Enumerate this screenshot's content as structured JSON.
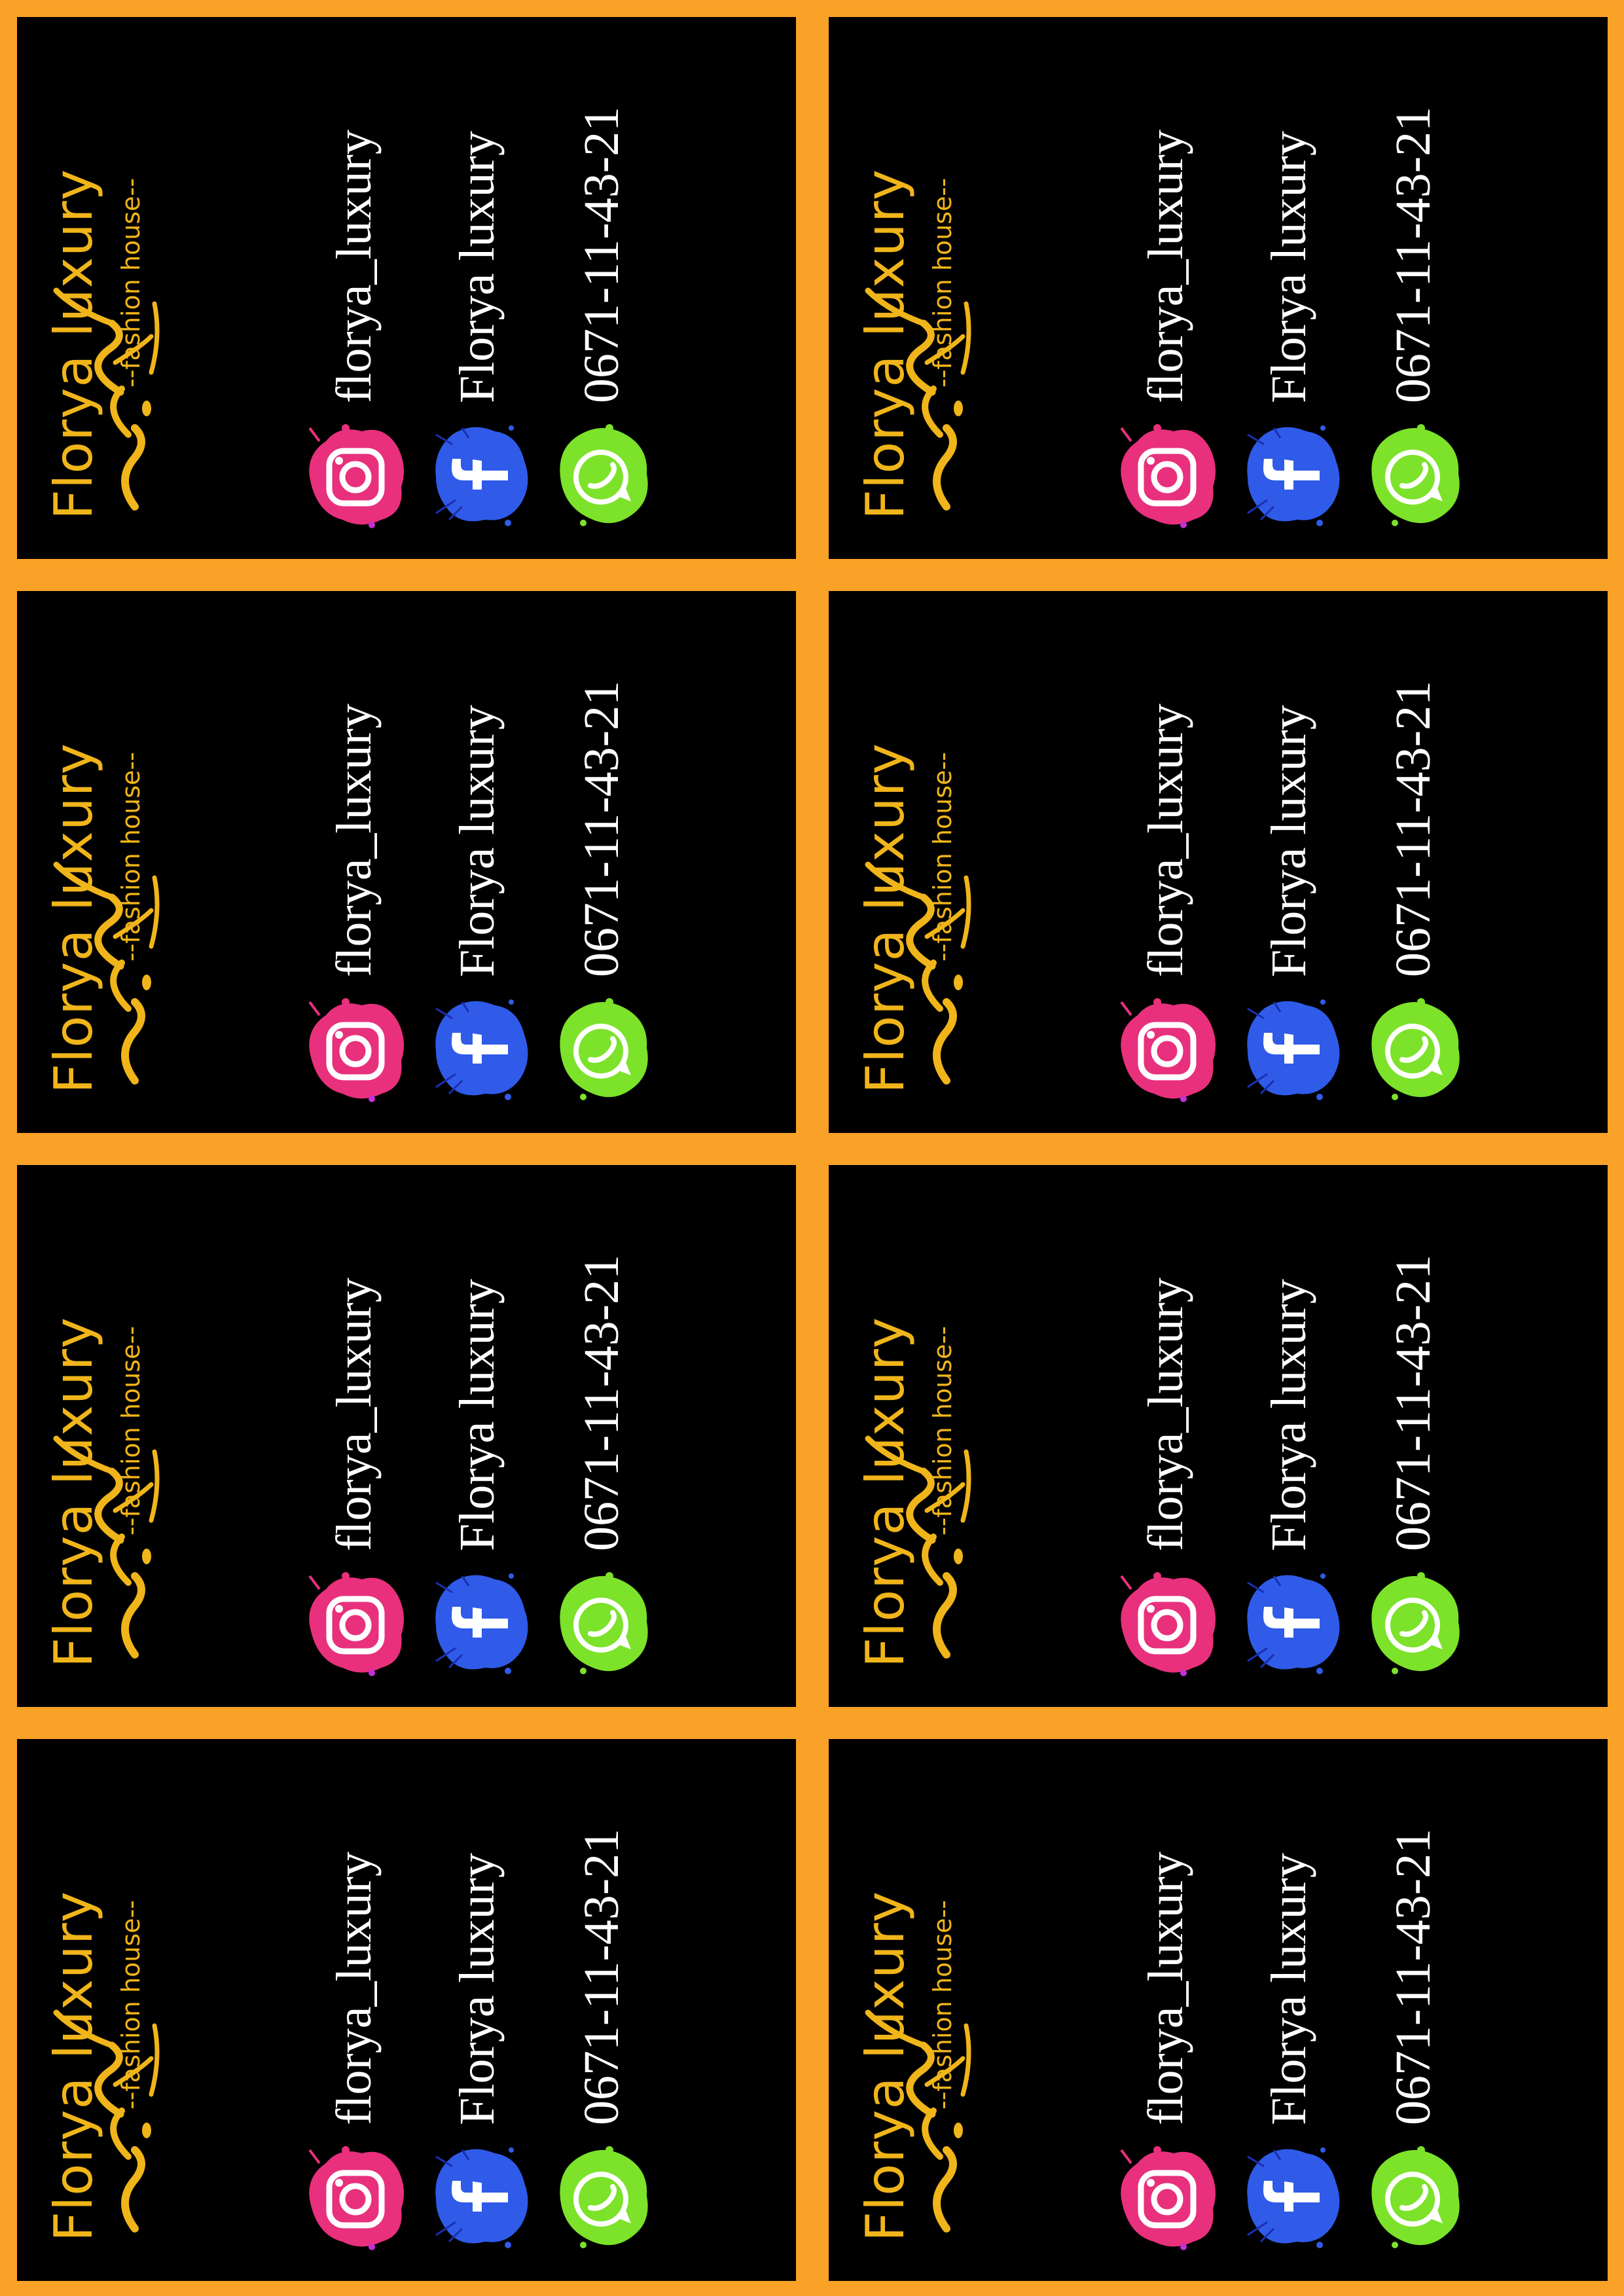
{
  "colors": {
    "background": "#F9A227",
    "card": "#000000",
    "gold": "#F0B51A",
    "instagram": "#E8307C",
    "facebook": "#2F5BE8",
    "whatsapp": "#7CE22A"
  },
  "card": {
    "brand": "Florya luxury",
    "tagline": "--fashion house--",
    "instagram": {
      "icon": "instagram-icon",
      "handle": "florya_luxury"
    },
    "facebook": {
      "icon": "facebook-icon",
      "handle": "Florya luxury"
    },
    "whatsapp": {
      "icon": "whatsapp-icon",
      "phone": "0671-11-43-21"
    }
  }
}
